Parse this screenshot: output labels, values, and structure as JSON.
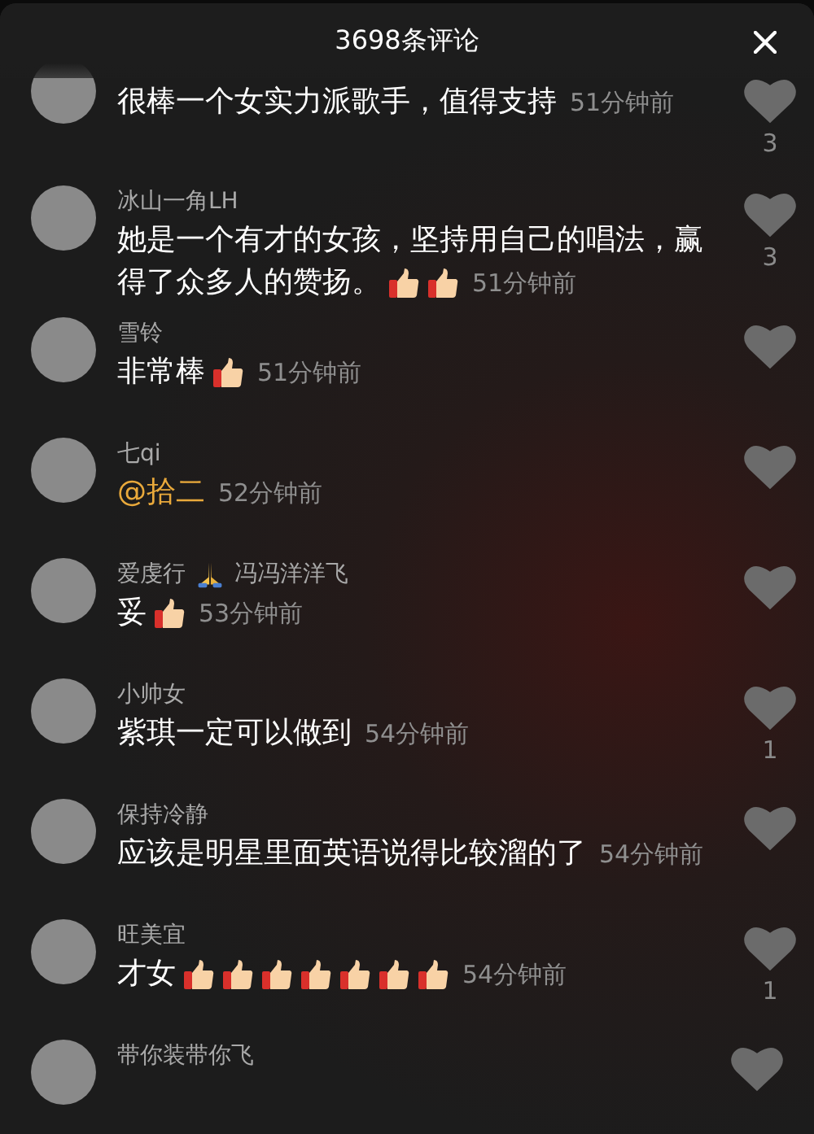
{
  "header": {
    "title": "3698条评论"
  },
  "comments": [
    {
      "body": [
        {
          "kind": "text",
          "text": "很棒一个女实力派歌手，值得支持"
        }
      ],
      "time": "51分钟前",
      "likes": "3"
    },
    {
      "name": [
        {
          "kind": "text",
          "text": "冰山一角LH"
        }
      ],
      "body": [
        {
          "kind": "text",
          "text": "她是一个有才的女孩，坚持用自己的唱法，赢"
        },
        {
          "kind": "break"
        },
        {
          "kind": "text",
          "text": "得了众多人的赞扬。"
        },
        {
          "kind": "thumbs-up"
        },
        {
          "kind": "thumbs-up"
        }
      ],
      "time": "51分钟前",
      "likes": "3"
    },
    {
      "name": [
        {
          "kind": "text",
          "text": "雪铃"
        }
      ],
      "body": [
        {
          "kind": "text",
          "text": "非常棒"
        },
        {
          "kind": "thumbs-up"
        }
      ],
      "time": "51分钟前"
    },
    {
      "name": [
        {
          "kind": "text",
          "text": "七qi"
        }
      ],
      "body": [
        {
          "kind": "mention",
          "text": "@拾二"
        }
      ],
      "time": "52分钟前"
    },
    {
      "name": [
        {
          "kind": "text",
          "text": "爱虔行"
        },
        {
          "kind": "pray"
        },
        {
          "kind": "text",
          "text": "冯冯洋洋飞"
        }
      ],
      "body": [
        {
          "kind": "text",
          "text": "妥"
        },
        {
          "kind": "thumbs-up"
        }
      ],
      "time": "53分钟前"
    },
    {
      "name": [
        {
          "kind": "text",
          "text": "小帅女"
        }
      ],
      "body": [
        {
          "kind": "text",
          "text": "紫琪一定可以做到"
        }
      ],
      "time": "54分钟前",
      "likes": "1"
    },
    {
      "name": [
        {
          "kind": "text",
          "text": "保持冷静"
        }
      ],
      "body": [
        {
          "kind": "text",
          "text": "应该是明星里面英语说得比较溜的了"
        }
      ],
      "time": "54分钟前"
    },
    {
      "name": [
        {
          "kind": "text",
          "text": "旺美宜"
        }
      ],
      "body": [
        {
          "kind": "text",
          "text": "才女"
        },
        {
          "kind": "thumbs-up"
        },
        {
          "kind": "thumbs-up"
        },
        {
          "kind": "thumbs-up"
        },
        {
          "kind": "thumbs-up"
        },
        {
          "kind": "thumbs-up"
        },
        {
          "kind": "thumbs-up"
        },
        {
          "kind": "thumbs-up"
        }
      ],
      "time": "54分钟前",
      "likes": "1"
    },
    {
      "name": [
        {
          "kind": "text",
          "text": "带你装带你飞"
        }
      ]
    }
  ]
}
